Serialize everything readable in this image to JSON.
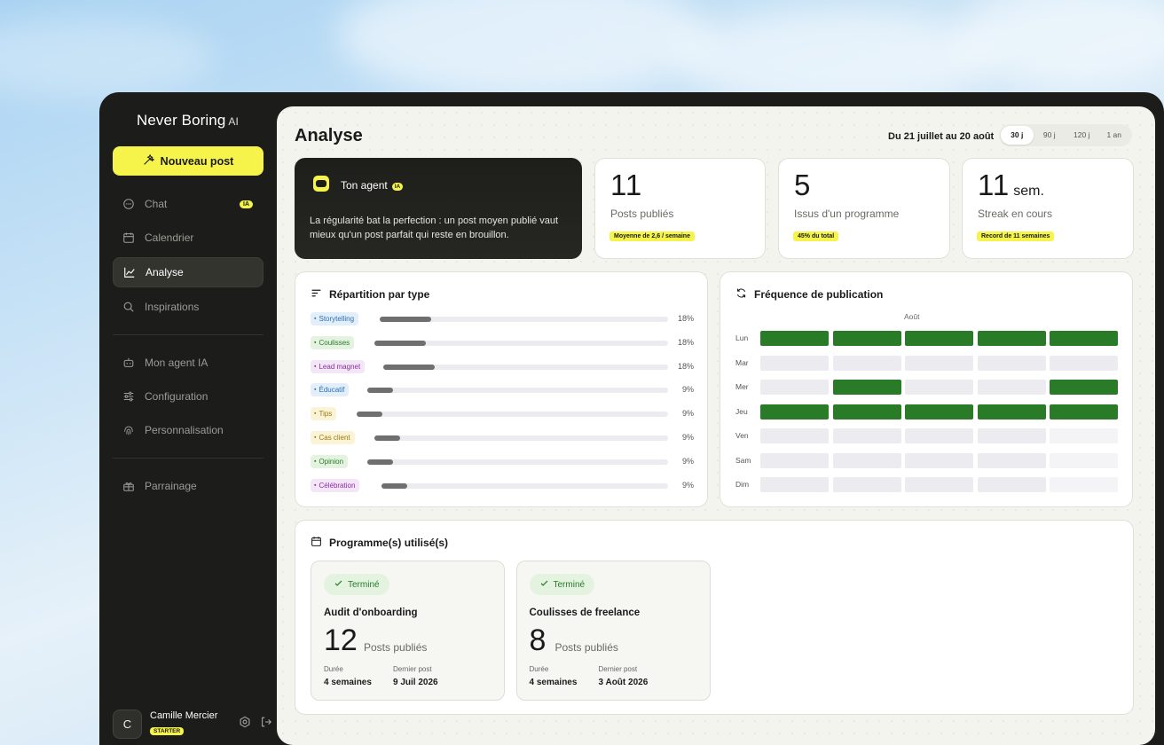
{
  "brand": {
    "name": "Never Boring",
    "suffix": "AI"
  },
  "sidebar": {
    "new_post": "Nouveau post",
    "items": [
      {
        "label": "Chat",
        "badge": "IA",
        "icon": "chat-bubble-icon"
      },
      {
        "label": "Calendrier",
        "icon": "calendar-icon"
      },
      {
        "label": "Analyse",
        "icon": "chart-line-icon",
        "active": true
      },
      {
        "label": "Inspirations",
        "icon": "search-icon"
      },
      {
        "label": "Mon agent IA",
        "icon": "robot-icon"
      },
      {
        "label": "Configuration",
        "icon": "sliders-icon"
      },
      {
        "label": "Personnalisation",
        "icon": "fingerprint-icon"
      },
      {
        "label": "Parrainage",
        "icon": "gift-icon"
      }
    ],
    "user": {
      "initial": "C",
      "name": "Camille Mercier",
      "plan": "STARTER"
    }
  },
  "header": {
    "title": "Analyse",
    "range": "Du 21 juillet au 20 août",
    "periods": [
      "30 j",
      "90 j",
      "120 j",
      "1 an"
    ],
    "active_period": "30 j"
  },
  "agent": {
    "title": "Ton agent",
    "badge": "IA",
    "message": "La régularité bat la perfection : un post moyen publié vaut mieux qu'un post parfait qui reste en brouillon."
  },
  "stats": [
    {
      "value": "11",
      "unit": "",
      "label": "Posts publiés",
      "pill": "Moyenne de 2,6 / semaine"
    },
    {
      "value": "5",
      "unit": "",
      "label": "Issus d'un programme",
      "pill": "45% du total"
    },
    {
      "value": "11",
      "unit": "sem.",
      "label": "Streak en cours",
      "pill": "Record de 11 semaines"
    }
  ],
  "types": {
    "title": "Répartition par type",
    "rows": [
      {
        "label": "Storytelling",
        "pct": "18%",
        "value": 18,
        "color": "#2b6fb0",
        "bg": "#e3eefb",
        "icon": "book-icon"
      },
      {
        "label": "Coulisses",
        "pct": "18%",
        "value": 18,
        "color": "#2a7b28",
        "bg": "#e3f3e0",
        "icon": "eye-icon"
      },
      {
        "label": "Lead magnet",
        "pct": "18%",
        "value": 18,
        "color": "#8a2f9e",
        "bg": "#f3e6f6",
        "icon": "magnet-icon"
      },
      {
        "label": "Éducatif",
        "pct": "9%",
        "value": 9,
        "color": "#2b6fb0",
        "bg": "#e3eefb",
        "icon": "graduation-cap-icon"
      },
      {
        "label": "Tips",
        "pct": "9%",
        "value": 9,
        "color": "#9a7a10",
        "bg": "#fbf3d6",
        "icon": "lightbulb-icon"
      },
      {
        "label": "Cas client",
        "pct": "9%",
        "value": 9,
        "color": "#9a7a10",
        "bg": "#fbf3d6",
        "icon": "users-icon"
      },
      {
        "label": "Opinion",
        "pct": "9%",
        "value": 9,
        "color": "#2a7b28",
        "bg": "#e3f3e0",
        "icon": "message-icon"
      },
      {
        "label": "Célébration",
        "pct": "9%",
        "value": 9,
        "color": "#8a2f9e",
        "bg": "#f3e6f6",
        "icon": "sparkle-icon"
      }
    ]
  },
  "frequency": {
    "title": "Fréquence de publication",
    "month": "Août",
    "days": [
      "Lun",
      "Mar",
      "Mer",
      "Jeu",
      "Ven",
      "Sam",
      "Dim"
    ],
    "grid": [
      [
        1,
        1,
        1,
        1,
        1
      ],
      [
        0,
        0,
        0,
        0,
        0
      ],
      [
        0,
        1,
        0,
        0,
        1
      ],
      [
        1,
        1,
        1,
        1,
        1
      ],
      [
        0,
        0,
        0,
        0,
        -1
      ],
      [
        0,
        0,
        0,
        0,
        -1
      ],
      [
        0,
        0,
        0,
        0,
        -1
      ]
    ]
  },
  "programs": {
    "title": "Programme(s) utilisé(s)",
    "items": [
      {
        "status": "Terminé",
        "name": "Audit d'onboarding",
        "count": "12",
        "count_label": "Posts publiés",
        "duration_label": "Durée",
        "duration": "4 semaines",
        "last_label": "Dernier post",
        "last": "9 Juil 2026"
      },
      {
        "status": "Terminé",
        "name": "Coulisses de freelance",
        "count": "8",
        "count_label": "Posts publiés",
        "duration_label": "Durée",
        "duration": "4 semaines",
        "last_label": "Dernier post",
        "last": "3 Août 2026"
      }
    ]
  }
}
